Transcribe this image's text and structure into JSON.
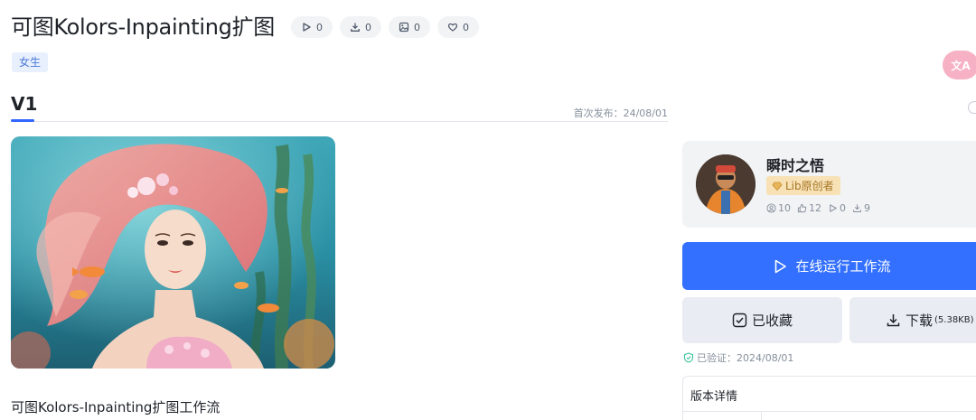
{
  "header": {
    "title": "可图Kolors-Inpainting扩图",
    "stats": [
      {
        "icon": "play-icon",
        "count": "0"
      },
      {
        "icon": "download-icon",
        "count": "0"
      },
      {
        "icon": "image-icon",
        "count": "0"
      },
      {
        "icon": "heart-icon",
        "count": "0"
      }
    ],
    "tag": "女生"
  },
  "translate": {
    "icon": "translate-icon",
    "label": "文A"
  },
  "version": {
    "tab_label": "V1",
    "publish_date": "首次发布：24/08/01"
  },
  "hero_image": {
    "description": "可图Kolors-Inpainting扩图工作流"
  },
  "description": "可图Kolors-Inpainting扩图工作流",
  "author": {
    "name": "瞬时之悟",
    "badge": "Lib原创者",
    "stats": [
      {
        "icon": "user-icon",
        "value": "10"
      },
      {
        "icon": "thumb-icon",
        "value": "12"
      },
      {
        "icon": "play-icon",
        "value": "0"
      },
      {
        "icon": "download-icon",
        "value": "9"
      }
    ]
  },
  "actions": {
    "run_label": "在线运行工作流",
    "favorite_label": "已收藏",
    "download_label": "下载",
    "download_size": "(5.38KB)"
  },
  "verified": "已验证：2024/08/01",
  "details": {
    "title": "版本详情"
  },
  "colors": {
    "accent": "#3370ff",
    "tag_bg": "#e8f0fe",
    "badge_bg": "#f7e1b5",
    "verified_green": "#36c29a"
  }
}
